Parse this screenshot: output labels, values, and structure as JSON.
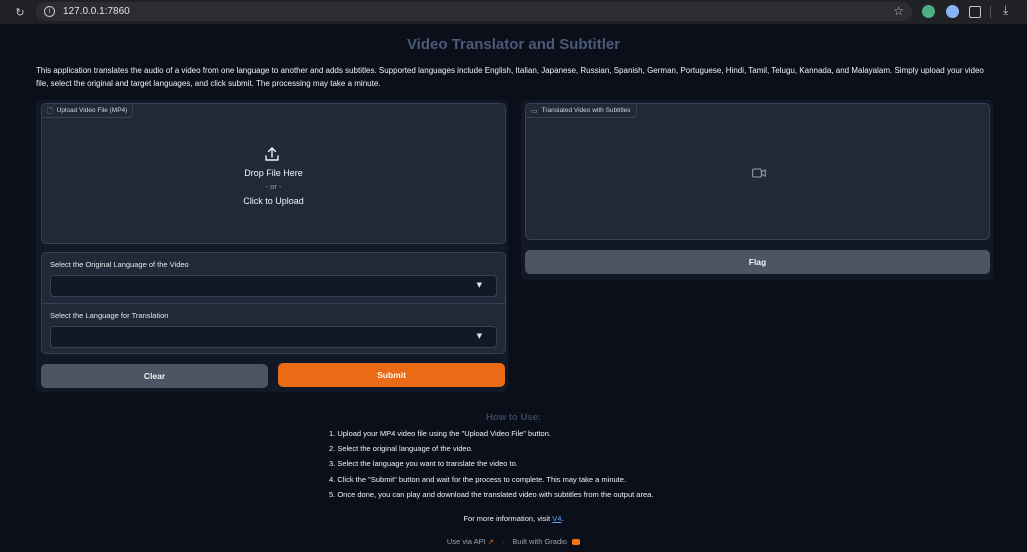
{
  "browser": {
    "url": "127.0.0.1:7860"
  },
  "app": {
    "title": "Video Translator and Subtitler",
    "description": "This application translates the audio of a video from one language to another and adds subtitles. Supported languages include English, Italian, Japanese, Russian, Spanish, German, Portuguese, Hindi, Tamil, Telugu, Kannada, and Malayalam. Simply upload your video file, select the original and target languages, and click submit. The processing may take a minute."
  },
  "upload": {
    "label": "Upload Video File (MP4)",
    "drop_text": "Drop File Here",
    "or_text": "- or -",
    "click_text": "Click to Upload"
  },
  "selects": {
    "original_label": "Select the Original Language of the Video",
    "original_value": "",
    "target_label": "Select the Language for Translation",
    "target_value": ""
  },
  "buttons": {
    "clear": "Clear",
    "submit": "Submit",
    "flag": "Flag"
  },
  "output": {
    "label": "Translated Video with Subtitles"
  },
  "howto": {
    "title": "How to Use:",
    "steps": [
      "1. Upload your MP4 video file using the \"Upload Video File\" button.",
      "2. Select the original language of the video.",
      "3. Select the language you want to translate the video to.",
      "4. Click the \"Submit\" button and wait for the process to complete. This may take a minute.",
      "5. Once done, you can play and download the translated video with subtitles from the output area."
    ],
    "more_prefix": "For more information, visit",
    "more_link": "V4",
    "more_suffix": "."
  },
  "footer": {
    "api": "Use via API",
    "separator": "·",
    "built": "Built with Gradio"
  },
  "colors": {
    "background": "#0b0f19",
    "submit": "#ea6a15",
    "secondary_button": "#4b5563",
    "link": "#60a5fa"
  }
}
